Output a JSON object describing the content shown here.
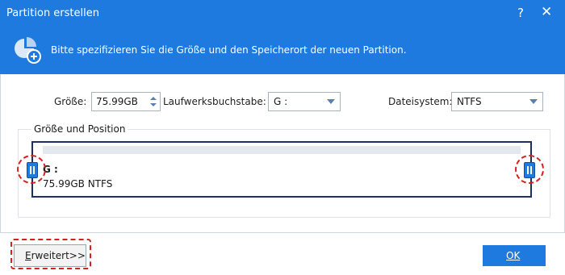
{
  "window": {
    "title": "Partition erstellen",
    "help_glyph": "?",
    "close_glyph": "✕"
  },
  "header": {
    "message": "Bitte spezifizieren Sie die Größe und den Speicherort der neuen Partition.",
    "icon": "partition-add-icon"
  },
  "fields": {
    "size_label": "Größe:",
    "size_value": "75.99GB",
    "drive_letter_label": "Laufwerksbuchstabe:",
    "drive_letter_value": "G :",
    "filesystem_label": "Dateisystem:",
    "filesystem_value": "NTFS"
  },
  "position_group": {
    "label": "Größe und Position",
    "partition_name": "G :",
    "partition_info": "75.99GB NTFS"
  },
  "buttons": {
    "advanced_first": "E",
    "advanced_rest": "rweitert>>",
    "ok": "OK"
  },
  "colors": {
    "accent": "#1f7ae0",
    "highlight": "#d81e1e",
    "partition_border": "#1c2f66"
  }
}
